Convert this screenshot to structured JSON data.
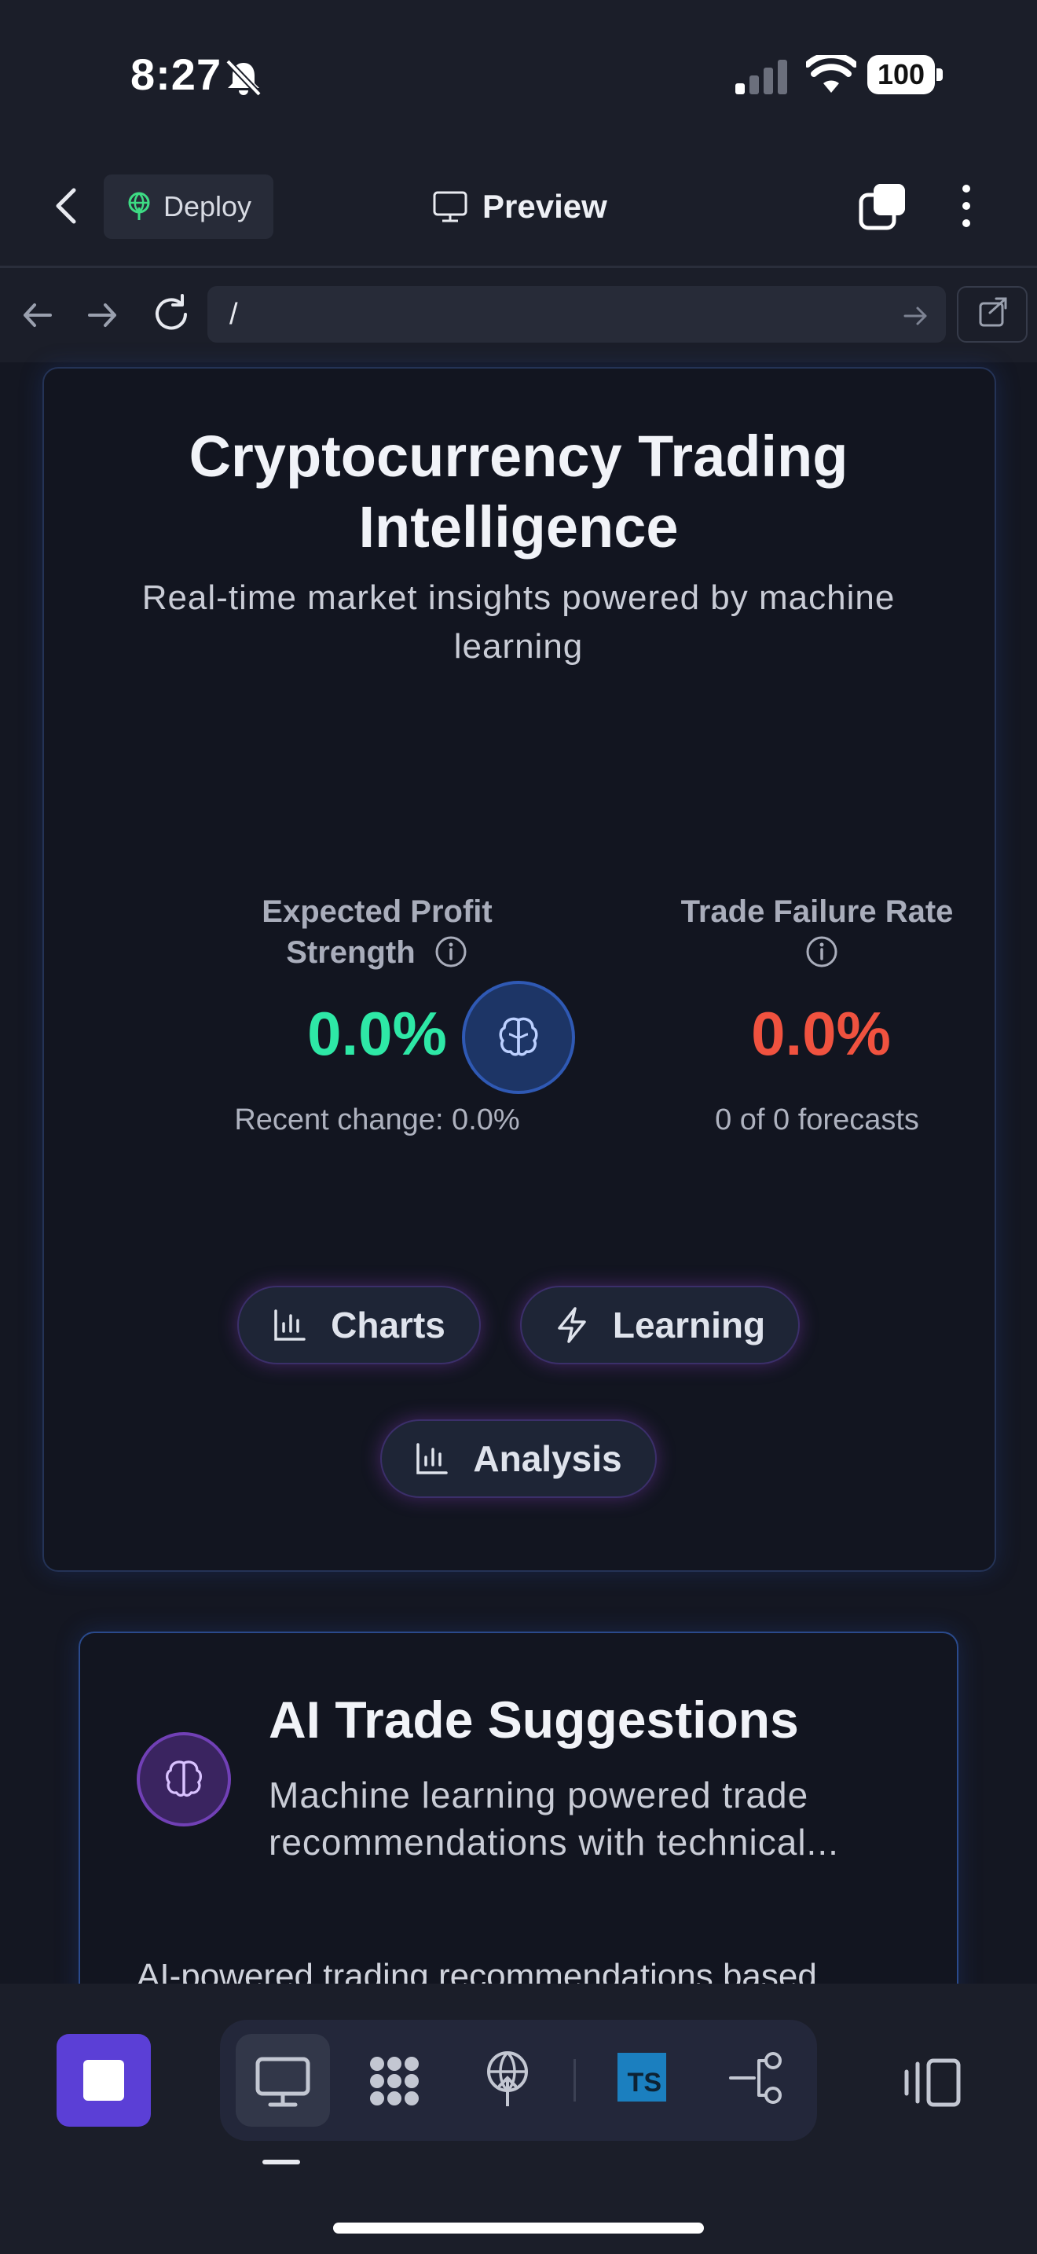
{
  "status_bar": {
    "time": "8:27",
    "battery": "100"
  },
  "toolbar": {
    "deploy_label": "Deploy",
    "preview_label": "Preview"
  },
  "url_bar": {
    "url": "/"
  },
  "hero": {
    "title": "Cryptocurrency Trading Intelligence",
    "subtitle": "Real-time market insights powered by machine learning"
  },
  "metrics": [
    {
      "label": "Expected Profit Strength",
      "value": "0.0%",
      "sub": "Recent change: 0.0%",
      "color": "#2ee8a6"
    },
    {
      "label": "Trade Failure Rate",
      "value": "0.0%",
      "sub": "0 of 0 forecasts",
      "color": "#f0523f"
    }
  ],
  "actions": {
    "charts": "Charts",
    "learning": "Learning",
    "analysis": "Analysis"
  },
  "suggestions_card": {
    "title": "AI Trade Suggestions",
    "description": "Machine learning powered trade recommendations with technical...",
    "body": "AI-powered trading recommendations based"
  },
  "colors": {
    "accent": "#5b3fd6",
    "profit": "#2ee8a6",
    "failure": "#f0523f",
    "background": "#1b1e29"
  },
  "icons": [
    "bell-slash-icon",
    "signal-icon",
    "wifi-icon",
    "chevron-left-icon",
    "globe-deploy-icon",
    "monitor-icon",
    "tabs-icon",
    "more-vertical-icon",
    "arrow-left-icon",
    "arrow-right-icon",
    "reload-icon",
    "external-link-icon",
    "info-icon",
    "brain-icon",
    "bar-chart-icon",
    "lightning-icon",
    "stop-icon",
    "dots-grid-icon",
    "antenna-icon",
    "typescript-icon",
    "git-branch-icon",
    "panel-icon"
  ]
}
